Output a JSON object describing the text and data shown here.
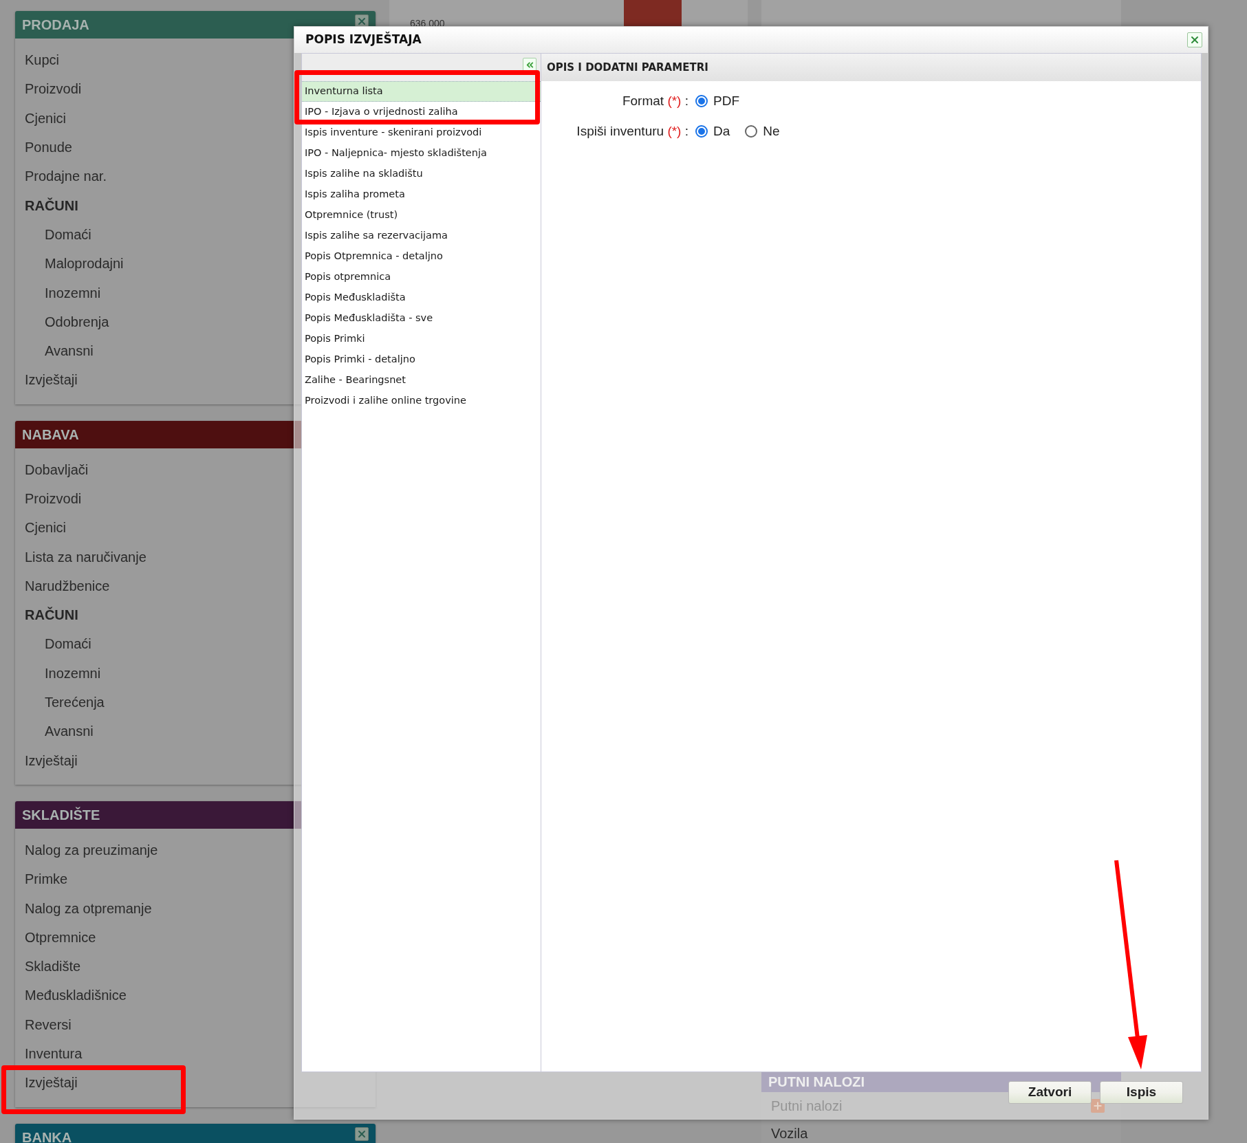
{
  "sidebar": {
    "sections": [
      {
        "title": "PRODAJA",
        "color": "#2c5e51",
        "closable": true,
        "items": [
          {
            "label": "Kupci",
            "kind": "item"
          },
          {
            "label": "Proizvodi",
            "kind": "item"
          },
          {
            "label": "Cjenici",
            "kind": "item"
          },
          {
            "label": "Ponude",
            "kind": "item"
          },
          {
            "label": "Prodajne nar.",
            "kind": "item"
          },
          {
            "label": "RAČUNI",
            "kind": "heading"
          },
          {
            "label": "Domaći",
            "kind": "subitem"
          },
          {
            "label": "Maloprodajni",
            "kind": "subitem"
          },
          {
            "label": "Inozemni",
            "kind": "subitem"
          },
          {
            "label": "Odobrenja",
            "kind": "subitem"
          },
          {
            "label": "Avansni",
            "kind": "subitem"
          },
          {
            "label": "Izvještaji",
            "kind": "item"
          }
        ]
      },
      {
        "title": "NABAVA",
        "color": "#4e0f10",
        "items": [
          {
            "label": "Dobavljači",
            "kind": "item"
          },
          {
            "label": "Proizvodi",
            "kind": "item"
          },
          {
            "label": "Cjenici",
            "kind": "item"
          },
          {
            "label": "Lista za naručivanje",
            "kind": "item"
          },
          {
            "label": "Narudžbenice",
            "kind": "item"
          },
          {
            "label": "RAČUNI",
            "kind": "heading"
          },
          {
            "label": "Domaći",
            "kind": "subitem"
          },
          {
            "label": "Inozemni",
            "kind": "subitem"
          },
          {
            "label": "Terećenja",
            "kind": "subitem"
          },
          {
            "label": "Avansni",
            "kind": "subitem"
          },
          {
            "label": "Izvještaji",
            "kind": "item"
          }
        ]
      },
      {
        "title": "SKLADIŠTE",
        "color": "#3a1838",
        "items": [
          {
            "label": "Nalog za preuzimanje",
            "kind": "item"
          },
          {
            "label": "Primke",
            "kind": "item"
          },
          {
            "label": "Nalog za otpremanje",
            "kind": "item"
          },
          {
            "label": "Otpremnice",
            "kind": "item"
          },
          {
            "label": "Skladište",
            "kind": "item"
          },
          {
            "label": "Međuskladišnice",
            "kind": "item"
          },
          {
            "label": "Reversi",
            "kind": "item"
          },
          {
            "label": "Inventura",
            "kind": "item"
          },
          {
            "label": "Izvještaji",
            "kind": "item"
          }
        ]
      },
      {
        "title": "BANKA",
        "color": "#0a5061",
        "closable": true
      }
    ]
  },
  "background": {
    "chart_label": "636 000",
    "panel": {
      "title": "PUTNI NALOZI",
      "items": [
        "Putni nalozi",
        "Vozila"
      ]
    }
  },
  "dialog": {
    "title": "POPIS IZVJEŠTAJA",
    "reports": [
      {
        "label": "Inventurna lista",
        "selected": true
      },
      {
        "label": "IPO - Izjava o vrijednosti zaliha",
        "selected": false
      },
      {
        "label": "Ispis inventure - skenirani proizvodi",
        "selected": false
      },
      {
        "label": "IPO - Naljepnica- mjesto skladištenja",
        "selected": false
      },
      {
        "label": "Ispis zalihe na skladištu",
        "selected": false
      },
      {
        "label": "Ispis zaliha prometa",
        "selected": false
      },
      {
        "label": "Otpremnice (trust)",
        "selected": false
      },
      {
        "label": "Ispis zalihe sa rezervacijama",
        "selected": false
      },
      {
        "label": "Popis Otpremnica - detaljno",
        "selected": false
      },
      {
        "label": "Popis otpremnica",
        "selected": false
      },
      {
        "label": "Popis Međuskladišta",
        "selected": false
      },
      {
        "label": "Popis Međuskladišta - sve",
        "selected": false
      },
      {
        "label": "Popis Primki",
        "selected": false
      },
      {
        "label": "Popis Primki - detaljno",
        "selected": false
      },
      {
        "label": "Zalihe - Bearingsnet",
        "selected": false
      },
      {
        "label": "Proizvodi i zalihe online trgovine",
        "selected": false
      }
    ],
    "params_title": "OPIS I DODATNI PARAMETRI",
    "params": [
      {
        "label": "Format",
        "required_mark": "(*)",
        "suffix": ":",
        "options": [
          {
            "label": "PDF",
            "selected": true
          }
        ]
      },
      {
        "label": "Ispiši inventuru",
        "required_mark": "(*)",
        "suffix": ":",
        "options": [
          {
            "label": "Da",
            "selected": true
          },
          {
            "label": "Ne",
            "selected": false
          }
        ]
      }
    ],
    "buttons": [
      "Zatvori",
      "Ispis"
    ]
  }
}
